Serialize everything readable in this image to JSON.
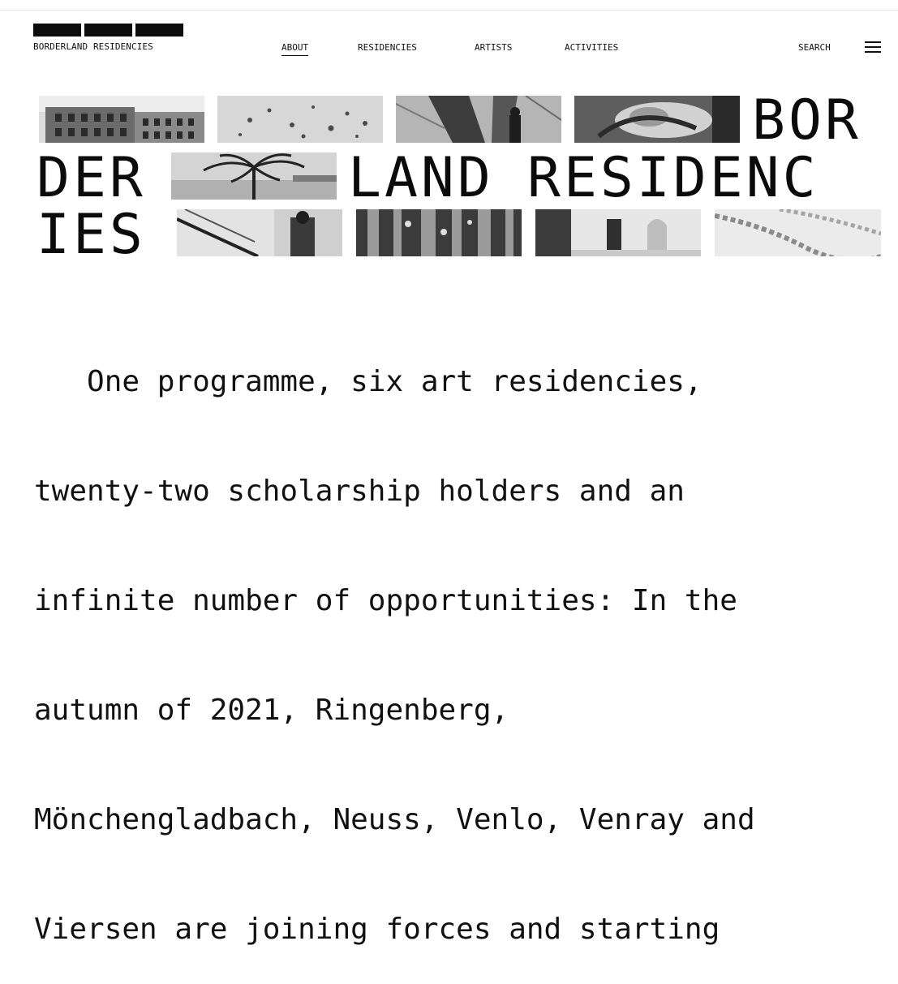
{
  "header": {
    "logo_text": "BORDERLAND RESIDENCIES",
    "nav": [
      {
        "label": "ABOUT",
        "active": true
      },
      {
        "label": "RESIDENCIES",
        "active": false
      },
      {
        "label": "ARTISTS",
        "active": false
      },
      {
        "label": "ACTIVITIES",
        "active": false
      }
    ],
    "search_label": "SEARCH"
  },
  "hero": {
    "line1": "BOR",
    "line2a": "DER",
    "line2b": "LAND",
    "line2c": "RESIDENC",
    "line3": "IES"
  },
  "intro": {
    "lines": [
      "   One programme, six art residencies,",
      "twenty-two scholarship holders and an",
      "infinite number of opportunities: In the",
      "autumn of 2021, Ringenberg,",
      "Mönchengladbach, Neuss, Venlo, Venray and",
      "Viersen are joining forces and starting"
    ]
  }
}
